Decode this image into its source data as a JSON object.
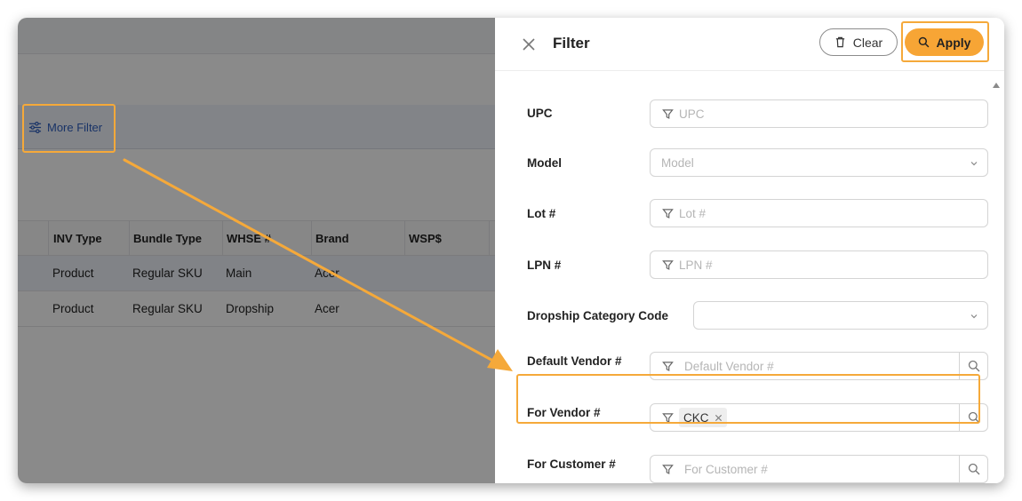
{
  "background": {
    "more_filter_label": "More Filter",
    "table": {
      "columns": [
        "INV Type",
        "Bundle Type",
        "WHSE #",
        "Brand",
        "WSP$"
      ],
      "rows": [
        [
          "Product",
          "Regular SKU",
          "Main",
          "Acer",
          ""
        ],
        [
          "Product",
          "Regular SKU",
          "Dropship",
          "Acer",
          ""
        ]
      ]
    }
  },
  "drawer": {
    "title": "Filter",
    "clear_label": "Clear",
    "apply_label": "Apply",
    "fields": {
      "upc": {
        "label": "UPC",
        "placeholder": "UPC"
      },
      "model": {
        "label": "Model",
        "placeholder": "Model"
      },
      "lot": {
        "label": "Lot #",
        "placeholder": "Lot #"
      },
      "lpn": {
        "label": "LPN #",
        "placeholder": "LPN #"
      },
      "dropship_category": {
        "label": "Dropship Category Code",
        "placeholder": ""
      },
      "default_vendor": {
        "label": "Default Vendor #",
        "placeholder": "Default Vendor #"
      },
      "for_vendor": {
        "label": "For Vendor #",
        "tag": "CKC"
      },
      "for_customer": {
        "label": "For Customer #",
        "placeholder": "For Customer #"
      }
    }
  },
  "colors": {
    "accent": "#f7a535",
    "highlight": "#f5a93a",
    "link": "#2f5fbf"
  }
}
